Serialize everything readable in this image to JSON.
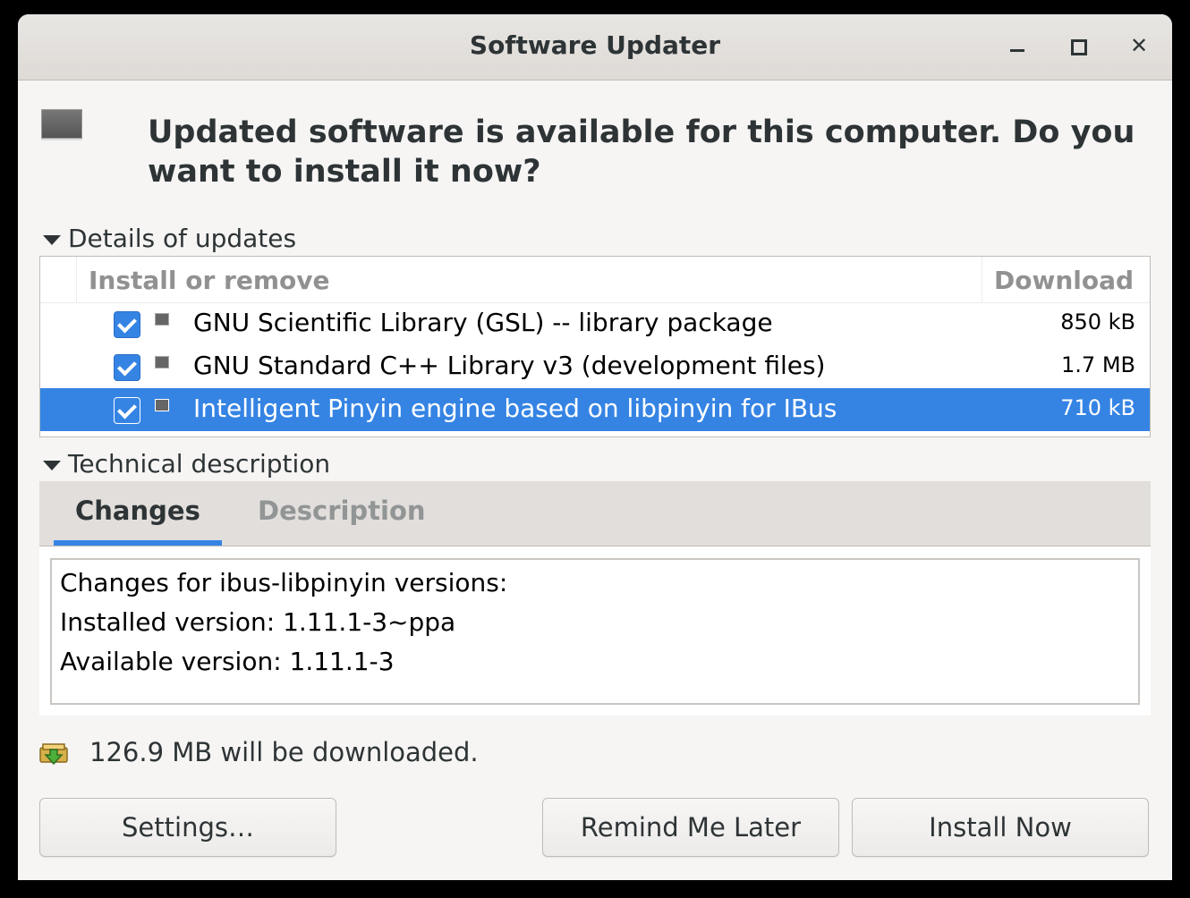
{
  "window": {
    "title": "Software Updater"
  },
  "headline": "Updated software is available for this computer. Do you want to install it now?",
  "details_expander": "Details of updates",
  "table": {
    "columns": [
      "Install or remove",
      "Download"
    ],
    "rows": [
      {
        "name": "GNU Scientific Library (GSL) -- library package",
        "size": "850 kB",
        "checked": true,
        "selected": false
      },
      {
        "name": "GNU Standard C++ Library v3 (development files)",
        "size": "1.7 MB",
        "checked": true,
        "selected": false
      },
      {
        "name": "Intelligent Pinyin engine based on libpinyin for IBus",
        "size": "710 kB",
        "checked": true,
        "selected": true
      }
    ]
  },
  "technical_expander": "Technical description",
  "tabs": [
    "Changes",
    "Description"
  ],
  "changes_text": [
    "Changes for ibus-libpinyin versions:",
    "Installed version: 1.11.1-3~ppa",
    "Available version: 1.11.1-3"
  ],
  "download_summary": "126.9 MB will be downloaded.",
  "buttons": {
    "settings": "Settings…",
    "remind": "Remind Me Later",
    "install": "Install Now"
  },
  "colors": {
    "accent": "#3584e4",
    "background": "#f6f5f4"
  }
}
